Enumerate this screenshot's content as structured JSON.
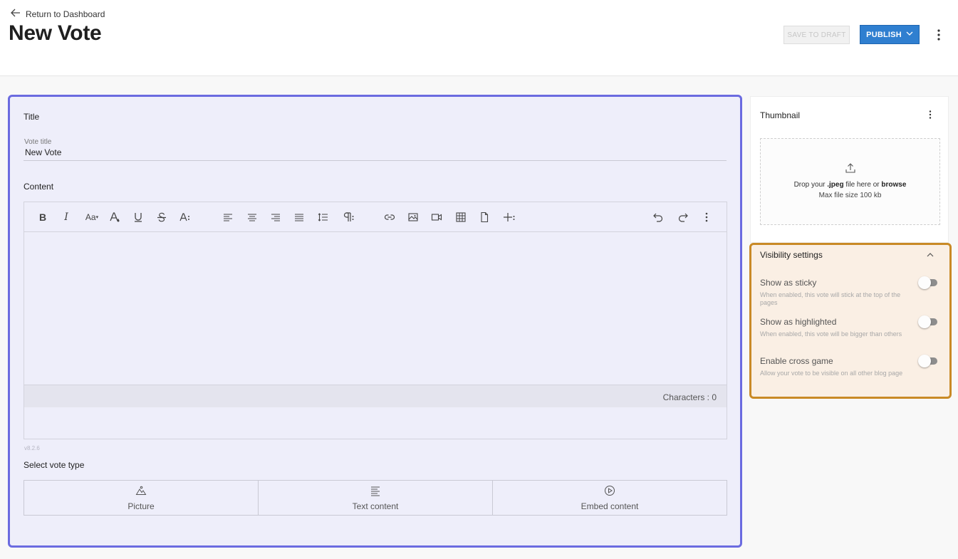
{
  "header": {
    "back_label": "Return to Dashboard",
    "title": "New Vote",
    "save_draft_label": "SAVE TO DRAFT",
    "publish_label": "PUBLISH"
  },
  "form": {
    "title_section": "Title",
    "vote_title_label": "Vote title",
    "vote_title_value": "New Vote",
    "content_section": "Content",
    "char_count": "Characters : 0",
    "version": "v8.2.6",
    "vote_type_section": "Select vote type",
    "vote_types": [
      "Picture",
      "Text content",
      "Embed content"
    ]
  },
  "toolbar_icons": [
    "bold-icon",
    "italic-icon",
    "font-size-icon",
    "text-color-icon",
    "underline-icon",
    "strikethrough-icon",
    "text-style-icon",
    "align-left-icon",
    "align-center-icon",
    "align-right-icon",
    "align-justify-icon",
    "line-height-icon",
    "paragraph-icon",
    "link-icon",
    "image-icon",
    "video-icon",
    "table-icon",
    "file-icon",
    "insert-more-icon",
    "undo-icon",
    "redo-icon",
    "more-icon"
  ],
  "thumbnail": {
    "title": "Thumbnail",
    "drop_prefix": "Drop your ",
    "drop_ext": ".jpeg",
    "drop_middle": " file here or ",
    "drop_browse": "browse",
    "max_size": "Max file size 100 kb"
  },
  "visibility": {
    "title": "Visibility settings",
    "items": [
      {
        "title": "Show as sticky",
        "desc": "When enabled, this vote will stick at the top of the pages",
        "enabled": false
      },
      {
        "title": "Show as highlighted",
        "desc": "When enabled, this vote will be bigger than others",
        "enabled": false
      },
      {
        "title": "Enable cross game",
        "desc": "Allow your vote to be visible on all other blog page",
        "enabled": false
      }
    ]
  },
  "colors": {
    "accent": "#2f7fd0",
    "editor_highlight": "#6b6be0",
    "visibility_highlight": "#c98a26"
  }
}
